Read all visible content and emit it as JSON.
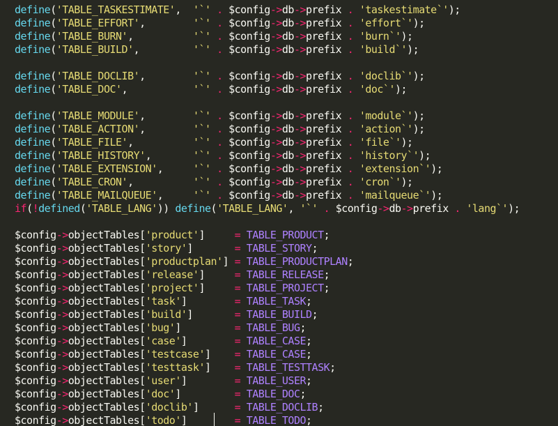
{
  "theme": {
    "background": "#272822",
    "foreground": "#f8f8f2",
    "function": "#66d9ef",
    "keyword_operator": "#f92672",
    "string": "#e6db74",
    "constant": "#ae81ff"
  },
  "lines": [
    [
      [
        "fn",
        "define"
      ],
      [
        "pun",
        "("
      ],
      [
        "str",
        "'TABLE_TASKESTIMATE'"
      ],
      [
        "pun",
        ",  "
      ],
      [
        "str",
        "'`'"
      ],
      [
        "pun",
        " "
      ],
      [
        "op",
        "."
      ],
      [
        "pun",
        " "
      ],
      [
        "var",
        "$config"
      ],
      [
        "op",
        "->"
      ],
      [
        "var",
        "db"
      ],
      [
        "op",
        "->"
      ],
      [
        "var",
        "prefix"
      ],
      [
        "pun",
        " "
      ],
      [
        "op",
        "."
      ],
      [
        "pun",
        " "
      ],
      [
        "str",
        "'taskestimate`'"
      ],
      [
        "pun",
        ");"
      ]
    ],
    [
      [
        "fn",
        "define"
      ],
      [
        "pun",
        "("
      ],
      [
        "str",
        "'TABLE_EFFORT'"
      ],
      [
        "pun",
        ",        "
      ],
      [
        "str",
        "'`'"
      ],
      [
        "pun",
        " "
      ],
      [
        "op",
        "."
      ],
      [
        "pun",
        " "
      ],
      [
        "var",
        "$config"
      ],
      [
        "op",
        "->"
      ],
      [
        "var",
        "db"
      ],
      [
        "op",
        "->"
      ],
      [
        "var",
        "prefix"
      ],
      [
        "pun",
        " "
      ],
      [
        "op",
        "."
      ],
      [
        "pun",
        " "
      ],
      [
        "str",
        "'effort`'"
      ],
      [
        "pun",
        ");"
      ]
    ],
    [
      [
        "fn",
        "define"
      ],
      [
        "pun",
        "("
      ],
      [
        "str",
        "'TABLE_BURN'"
      ],
      [
        "pun",
        ",          "
      ],
      [
        "str",
        "'`'"
      ],
      [
        "pun",
        " "
      ],
      [
        "op",
        "."
      ],
      [
        "pun",
        " "
      ],
      [
        "var",
        "$config"
      ],
      [
        "op",
        "->"
      ],
      [
        "var",
        "db"
      ],
      [
        "op",
        "->"
      ],
      [
        "var",
        "prefix"
      ],
      [
        "pun",
        " "
      ],
      [
        "op",
        "."
      ],
      [
        "pun",
        " "
      ],
      [
        "str",
        "'burn`'"
      ],
      [
        "pun",
        ");"
      ]
    ],
    [
      [
        "fn",
        "define"
      ],
      [
        "pun",
        "("
      ],
      [
        "str",
        "'TABLE_BUILD'"
      ],
      [
        "pun",
        ",         "
      ],
      [
        "str",
        "'`'"
      ],
      [
        "pun",
        " "
      ],
      [
        "op",
        "."
      ],
      [
        "pun",
        " "
      ],
      [
        "var",
        "$config"
      ],
      [
        "op",
        "->"
      ],
      [
        "var",
        "db"
      ],
      [
        "op",
        "->"
      ],
      [
        "var",
        "prefix"
      ],
      [
        "pun",
        " "
      ],
      [
        "op",
        "."
      ],
      [
        "pun",
        " "
      ],
      [
        "str",
        "'build`'"
      ],
      [
        "pun",
        ");"
      ]
    ],
    [],
    [
      [
        "fn",
        "define"
      ],
      [
        "pun",
        "("
      ],
      [
        "str",
        "'TABLE_DOCLIB'"
      ],
      [
        "pun",
        ",        "
      ],
      [
        "str",
        "'`'"
      ],
      [
        "pun",
        " "
      ],
      [
        "op",
        "."
      ],
      [
        "pun",
        " "
      ],
      [
        "var",
        "$config"
      ],
      [
        "op",
        "->"
      ],
      [
        "var",
        "db"
      ],
      [
        "op",
        "->"
      ],
      [
        "var",
        "prefix"
      ],
      [
        "pun",
        " "
      ],
      [
        "op",
        "."
      ],
      [
        "pun",
        " "
      ],
      [
        "str",
        "'doclib`'"
      ],
      [
        "pun",
        ");"
      ]
    ],
    [
      [
        "fn",
        "define"
      ],
      [
        "pun",
        "("
      ],
      [
        "str",
        "'TABLE_DOC'"
      ],
      [
        "pun",
        ",           "
      ],
      [
        "str",
        "'`'"
      ],
      [
        "pun",
        " "
      ],
      [
        "op",
        "."
      ],
      [
        "pun",
        " "
      ],
      [
        "var",
        "$config"
      ],
      [
        "op",
        "->"
      ],
      [
        "var",
        "db"
      ],
      [
        "op",
        "->"
      ],
      [
        "var",
        "prefix"
      ],
      [
        "pun",
        " "
      ],
      [
        "op",
        "."
      ],
      [
        "pun",
        " "
      ],
      [
        "str",
        "'doc`'"
      ],
      [
        "pun",
        ");"
      ]
    ],
    [],
    [
      [
        "fn",
        "define"
      ],
      [
        "pun",
        "("
      ],
      [
        "str",
        "'TABLE_MODULE'"
      ],
      [
        "pun",
        ",        "
      ],
      [
        "str",
        "'`'"
      ],
      [
        "pun",
        " "
      ],
      [
        "op",
        "."
      ],
      [
        "pun",
        " "
      ],
      [
        "var",
        "$config"
      ],
      [
        "op",
        "->"
      ],
      [
        "var",
        "db"
      ],
      [
        "op",
        "->"
      ],
      [
        "var",
        "prefix"
      ],
      [
        "pun",
        " "
      ],
      [
        "op",
        "."
      ],
      [
        "pun",
        " "
      ],
      [
        "str",
        "'module`'"
      ],
      [
        "pun",
        ");"
      ]
    ],
    [
      [
        "fn",
        "define"
      ],
      [
        "pun",
        "("
      ],
      [
        "str",
        "'TABLE_ACTION'"
      ],
      [
        "pun",
        ",        "
      ],
      [
        "str",
        "'`'"
      ],
      [
        "pun",
        " "
      ],
      [
        "op",
        "."
      ],
      [
        "pun",
        " "
      ],
      [
        "var",
        "$config"
      ],
      [
        "op",
        "->"
      ],
      [
        "var",
        "db"
      ],
      [
        "op",
        "->"
      ],
      [
        "var",
        "prefix"
      ],
      [
        "pun",
        " "
      ],
      [
        "op",
        "."
      ],
      [
        "pun",
        " "
      ],
      [
        "str",
        "'action`'"
      ],
      [
        "pun",
        ");"
      ]
    ],
    [
      [
        "fn",
        "define"
      ],
      [
        "pun",
        "("
      ],
      [
        "str",
        "'TABLE_FILE'"
      ],
      [
        "pun",
        ",          "
      ],
      [
        "str",
        "'`'"
      ],
      [
        "pun",
        " "
      ],
      [
        "op",
        "."
      ],
      [
        "pun",
        " "
      ],
      [
        "var",
        "$config"
      ],
      [
        "op",
        "->"
      ],
      [
        "var",
        "db"
      ],
      [
        "op",
        "->"
      ],
      [
        "var",
        "prefix"
      ],
      [
        "pun",
        " "
      ],
      [
        "op",
        "."
      ],
      [
        "pun",
        " "
      ],
      [
        "str",
        "'file`'"
      ],
      [
        "pun",
        ");"
      ]
    ],
    [
      [
        "fn",
        "define"
      ],
      [
        "pun",
        "("
      ],
      [
        "str",
        "'TABLE_HISTORY'"
      ],
      [
        "pun",
        ",       "
      ],
      [
        "str",
        "'`'"
      ],
      [
        "pun",
        " "
      ],
      [
        "op",
        "."
      ],
      [
        "pun",
        " "
      ],
      [
        "var",
        "$config"
      ],
      [
        "op",
        "->"
      ],
      [
        "var",
        "db"
      ],
      [
        "op",
        "->"
      ],
      [
        "var",
        "prefix"
      ],
      [
        "pun",
        " "
      ],
      [
        "op",
        "."
      ],
      [
        "pun",
        " "
      ],
      [
        "str",
        "'history`'"
      ],
      [
        "pun",
        ");"
      ]
    ],
    [
      [
        "fn",
        "define"
      ],
      [
        "pun",
        "("
      ],
      [
        "str",
        "'TABLE_EXTENSION'"
      ],
      [
        "pun",
        ",     "
      ],
      [
        "str",
        "'`'"
      ],
      [
        "pun",
        " "
      ],
      [
        "op",
        "."
      ],
      [
        "pun",
        " "
      ],
      [
        "var",
        "$config"
      ],
      [
        "op",
        "->"
      ],
      [
        "var",
        "db"
      ],
      [
        "op",
        "->"
      ],
      [
        "var",
        "prefix"
      ],
      [
        "pun",
        " "
      ],
      [
        "op",
        "."
      ],
      [
        "pun",
        " "
      ],
      [
        "str",
        "'extension`'"
      ],
      [
        "pun",
        ");"
      ]
    ],
    [
      [
        "fn",
        "define"
      ],
      [
        "pun",
        "("
      ],
      [
        "str",
        "'TABLE_CRON'"
      ],
      [
        "pun",
        ",          "
      ],
      [
        "str",
        "'`'"
      ],
      [
        "pun",
        " "
      ],
      [
        "op",
        "."
      ],
      [
        "pun",
        " "
      ],
      [
        "var",
        "$config"
      ],
      [
        "op",
        "->"
      ],
      [
        "var",
        "db"
      ],
      [
        "op",
        "->"
      ],
      [
        "var",
        "prefix"
      ],
      [
        "pun",
        " "
      ],
      [
        "op",
        "."
      ],
      [
        "pun",
        " "
      ],
      [
        "str",
        "'cron`'"
      ],
      [
        "pun",
        ");"
      ]
    ],
    [
      [
        "fn",
        "define"
      ],
      [
        "pun",
        "("
      ],
      [
        "str",
        "'TABLE_MAILQUEUE'"
      ],
      [
        "pun",
        ",     "
      ],
      [
        "str",
        "'`'"
      ],
      [
        "pun",
        " "
      ],
      [
        "op",
        "."
      ],
      [
        "pun",
        " "
      ],
      [
        "var",
        "$config"
      ],
      [
        "op",
        "->"
      ],
      [
        "var",
        "db"
      ],
      [
        "op",
        "->"
      ],
      [
        "var",
        "prefix"
      ],
      [
        "pun",
        " "
      ],
      [
        "op",
        "."
      ],
      [
        "pun",
        " "
      ],
      [
        "str",
        "'mailqueue`'"
      ],
      [
        "pun",
        ");"
      ]
    ],
    [
      [
        "kw",
        "if"
      ],
      [
        "pun",
        "("
      ],
      [
        "op",
        "!"
      ],
      [
        "fn",
        "defined"
      ],
      [
        "pun",
        "("
      ],
      [
        "str",
        "'TABLE_LANG'"
      ],
      [
        "pun",
        ")) "
      ],
      [
        "fn",
        "define"
      ],
      [
        "pun",
        "("
      ],
      [
        "str",
        "'TABLE_LANG'"
      ],
      [
        "pun",
        ", "
      ],
      [
        "str",
        "'`'"
      ],
      [
        "pun",
        " "
      ],
      [
        "op",
        "."
      ],
      [
        "pun",
        " "
      ],
      [
        "var",
        "$config"
      ],
      [
        "op",
        "->"
      ],
      [
        "var",
        "db"
      ],
      [
        "op",
        "->"
      ],
      [
        "var",
        "prefix"
      ],
      [
        "pun",
        " "
      ],
      [
        "op",
        "."
      ],
      [
        "pun",
        " "
      ],
      [
        "str",
        "'lang`'"
      ],
      [
        "pun",
        ");"
      ]
    ],
    [],
    [
      [
        "var",
        "$config"
      ],
      [
        "op",
        "->"
      ],
      [
        "var",
        "objectTables"
      ],
      [
        "pun",
        "["
      ],
      [
        "str",
        "'product'"
      ],
      [
        "pun",
        "]     "
      ],
      [
        "op",
        "="
      ],
      [
        "pun",
        " "
      ],
      [
        "const",
        "TABLE_PRODUCT"
      ],
      [
        "pun",
        ";"
      ]
    ],
    [
      [
        "var",
        "$config"
      ],
      [
        "op",
        "->"
      ],
      [
        "var",
        "objectTables"
      ],
      [
        "pun",
        "["
      ],
      [
        "str",
        "'story'"
      ],
      [
        "pun",
        "]       "
      ],
      [
        "op",
        "="
      ],
      [
        "pun",
        " "
      ],
      [
        "const",
        "TABLE_STORY"
      ],
      [
        "pun",
        ";"
      ]
    ],
    [
      [
        "var",
        "$config"
      ],
      [
        "op",
        "->"
      ],
      [
        "var",
        "objectTables"
      ],
      [
        "pun",
        "["
      ],
      [
        "str",
        "'productplan'"
      ],
      [
        "pun",
        "] "
      ],
      [
        "op",
        "="
      ],
      [
        "pun",
        " "
      ],
      [
        "const",
        "TABLE_PRODUCTPLAN"
      ],
      [
        "pun",
        ";"
      ]
    ],
    [
      [
        "var",
        "$config"
      ],
      [
        "op",
        "->"
      ],
      [
        "var",
        "objectTables"
      ],
      [
        "pun",
        "["
      ],
      [
        "str",
        "'release'"
      ],
      [
        "pun",
        "]     "
      ],
      [
        "op",
        "="
      ],
      [
        "pun",
        " "
      ],
      [
        "const",
        "TABLE_RELEASE"
      ],
      [
        "pun",
        ";"
      ]
    ],
    [
      [
        "var",
        "$config"
      ],
      [
        "op",
        "->"
      ],
      [
        "var",
        "objectTables"
      ],
      [
        "pun",
        "["
      ],
      [
        "str",
        "'project'"
      ],
      [
        "pun",
        "]     "
      ],
      [
        "op",
        "="
      ],
      [
        "pun",
        " "
      ],
      [
        "const",
        "TABLE_PROJECT"
      ],
      [
        "pun",
        ";"
      ]
    ],
    [
      [
        "var",
        "$config"
      ],
      [
        "op",
        "->"
      ],
      [
        "var",
        "objectTables"
      ],
      [
        "pun",
        "["
      ],
      [
        "str",
        "'task'"
      ],
      [
        "pun",
        "]        "
      ],
      [
        "op",
        "="
      ],
      [
        "pun",
        " "
      ],
      [
        "const",
        "TABLE_TASK"
      ],
      [
        "pun",
        ";"
      ]
    ],
    [
      [
        "var",
        "$config"
      ],
      [
        "op",
        "->"
      ],
      [
        "var",
        "objectTables"
      ],
      [
        "pun",
        "["
      ],
      [
        "str",
        "'build'"
      ],
      [
        "pun",
        "]       "
      ],
      [
        "op",
        "="
      ],
      [
        "pun",
        " "
      ],
      [
        "const",
        "TABLE_BUILD"
      ],
      [
        "pun",
        ";"
      ]
    ],
    [
      [
        "var",
        "$config"
      ],
      [
        "op",
        "->"
      ],
      [
        "var",
        "objectTables"
      ],
      [
        "pun",
        "["
      ],
      [
        "str",
        "'bug'"
      ],
      [
        "pun",
        "]         "
      ],
      [
        "op",
        "="
      ],
      [
        "pun",
        " "
      ],
      [
        "const",
        "TABLE_BUG"
      ],
      [
        "pun",
        ";"
      ]
    ],
    [
      [
        "var",
        "$config"
      ],
      [
        "op",
        "->"
      ],
      [
        "var",
        "objectTables"
      ],
      [
        "pun",
        "["
      ],
      [
        "str",
        "'case'"
      ],
      [
        "pun",
        "]        "
      ],
      [
        "op",
        "="
      ],
      [
        "pun",
        " "
      ],
      [
        "const",
        "TABLE_CASE"
      ],
      [
        "pun",
        ";"
      ]
    ],
    [
      [
        "var",
        "$config"
      ],
      [
        "op",
        "->"
      ],
      [
        "var",
        "objectTables"
      ],
      [
        "pun",
        "["
      ],
      [
        "str",
        "'testcase'"
      ],
      [
        "pun",
        "]    "
      ],
      [
        "op",
        "="
      ],
      [
        "pun",
        " "
      ],
      [
        "const",
        "TABLE_CASE"
      ],
      [
        "pun",
        ";"
      ]
    ],
    [
      [
        "var",
        "$config"
      ],
      [
        "op",
        "->"
      ],
      [
        "var",
        "objectTables"
      ],
      [
        "pun",
        "["
      ],
      [
        "str",
        "'testtask'"
      ],
      [
        "pun",
        "]    "
      ],
      [
        "op",
        "="
      ],
      [
        "pun",
        " "
      ],
      [
        "const",
        "TABLE_TESTTASK"
      ],
      [
        "pun",
        ";"
      ]
    ],
    [
      [
        "var",
        "$config"
      ],
      [
        "op",
        "->"
      ],
      [
        "var",
        "objectTables"
      ],
      [
        "pun",
        "["
      ],
      [
        "str",
        "'user'"
      ],
      [
        "pun",
        "]        "
      ],
      [
        "op",
        "="
      ],
      [
        "pun",
        " "
      ],
      [
        "const",
        "TABLE_USER"
      ],
      [
        "pun",
        ";"
      ]
    ],
    [
      [
        "var",
        "$config"
      ],
      [
        "op",
        "->"
      ],
      [
        "var",
        "objectTables"
      ],
      [
        "pun",
        "["
      ],
      [
        "str",
        "'doc'"
      ],
      [
        "pun",
        "]         "
      ],
      [
        "op",
        "="
      ],
      [
        "pun",
        " "
      ],
      [
        "const",
        "TABLE_DOC"
      ],
      [
        "pun",
        ";"
      ]
    ],
    [
      [
        "var",
        "$config"
      ],
      [
        "op",
        "->"
      ],
      [
        "var",
        "objectTables"
      ],
      [
        "pun",
        "["
      ],
      [
        "str",
        "'doclib'"
      ],
      [
        "pun",
        "]      "
      ],
      [
        "op",
        "="
      ],
      [
        "pun",
        " "
      ],
      [
        "const",
        "TABLE_DOCLIB"
      ],
      [
        "pun",
        ";"
      ]
    ],
    [
      [
        "var",
        "$config"
      ],
      [
        "op",
        "->"
      ],
      [
        "var",
        "objectTables"
      ],
      [
        "pun",
        "["
      ],
      [
        "str",
        "'todo'"
      ],
      [
        "pun",
        "]        "
      ],
      [
        "op",
        "="
      ],
      [
        "pun",
        " "
      ],
      [
        "const",
        "TABLE_TODO"
      ],
      [
        "pun",
        ";"
      ]
    ]
  ]
}
